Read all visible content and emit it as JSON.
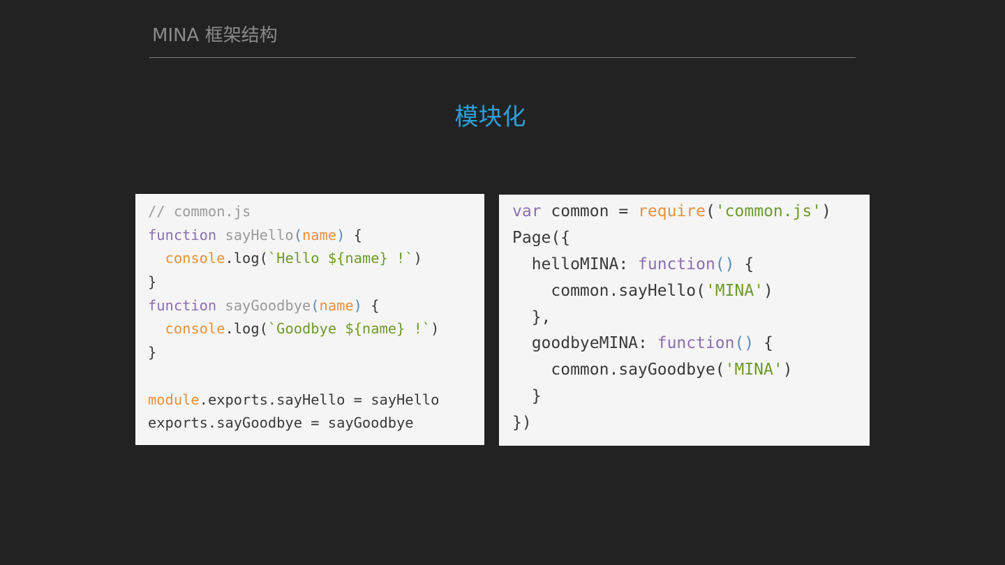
{
  "header": {
    "title": "MINA  框架结构"
  },
  "slide": {
    "title": "模块化"
  },
  "left_code": [
    [
      [
        "// common.js",
        "cm"
      ]
    ],
    [
      [
        "function",
        "kw"
      ],
      [
        " sayHello",
        "fn"
      ],
      [
        "(",
        "pu"
      ],
      [
        "name",
        "pr"
      ],
      [
        ")",
        "pu"
      ],
      [
        " {",
        "pl"
      ]
    ],
    [
      [
        "  console",
        "pr"
      ],
      [
        ".log(",
        "pl"
      ],
      [
        "`Hello ${name} !`",
        "st"
      ],
      [
        ")",
        "pl"
      ]
    ],
    [
      [
        "}",
        "pl"
      ]
    ],
    [
      [
        "function",
        "kw"
      ],
      [
        " sayGoodbye",
        "fn"
      ],
      [
        "(",
        "pu"
      ],
      [
        "name",
        "pr"
      ],
      [
        ")",
        "pu"
      ],
      [
        " {",
        "pl"
      ]
    ],
    [
      [
        "  console",
        "pr"
      ],
      [
        ".log(",
        "pl"
      ],
      [
        "`Goodbye ${name} !`",
        "st"
      ],
      [
        ")",
        "pl"
      ]
    ],
    [
      [
        "}",
        "pl"
      ]
    ],
    [
      [
        "",
        "pl"
      ]
    ],
    [
      [
        "module",
        "pr"
      ],
      [
        ".exports.sayHello = sayHello",
        "pl"
      ]
    ],
    [
      [
        "exports.sayGoodbye = sayGoodbye",
        "pl"
      ]
    ]
  ],
  "right_code": [
    [
      [
        "var",
        "kw"
      ],
      [
        " common = ",
        "pl"
      ],
      [
        "require",
        "pr"
      ],
      [
        "(",
        "pl"
      ],
      [
        "'common.js'",
        "st"
      ],
      [
        ")",
        "pl"
      ]
    ],
    [
      [
        "Page({",
        "pl"
      ]
    ],
    [
      [
        "  helloMINA: ",
        "pl"
      ],
      [
        "function",
        "kw"
      ],
      [
        "()",
        "pu"
      ],
      [
        " {",
        "pl"
      ]
    ],
    [
      [
        "    common.sayHello(",
        "pl"
      ],
      [
        "'MINA'",
        "st"
      ],
      [
        ")",
        "pl"
      ]
    ],
    [
      [
        "  },",
        "pl"
      ]
    ],
    [
      [
        "  goodbyeMINA: ",
        "pl"
      ],
      [
        "function",
        "kw"
      ],
      [
        "()",
        "pu"
      ],
      [
        " {",
        "pl"
      ]
    ],
    [
      [
        "    common.sayGoodbye(",
        "pl"
      ],
      [
        "'MINA'",
        "st"
      ],
      [
        ")",
        "pl"
      ]
    ],
    [
      [
        "  }",
        "pl"
      ]
    ],
    [
      [
        "})",
        "pl"
      ]
    ]
  ]
}
